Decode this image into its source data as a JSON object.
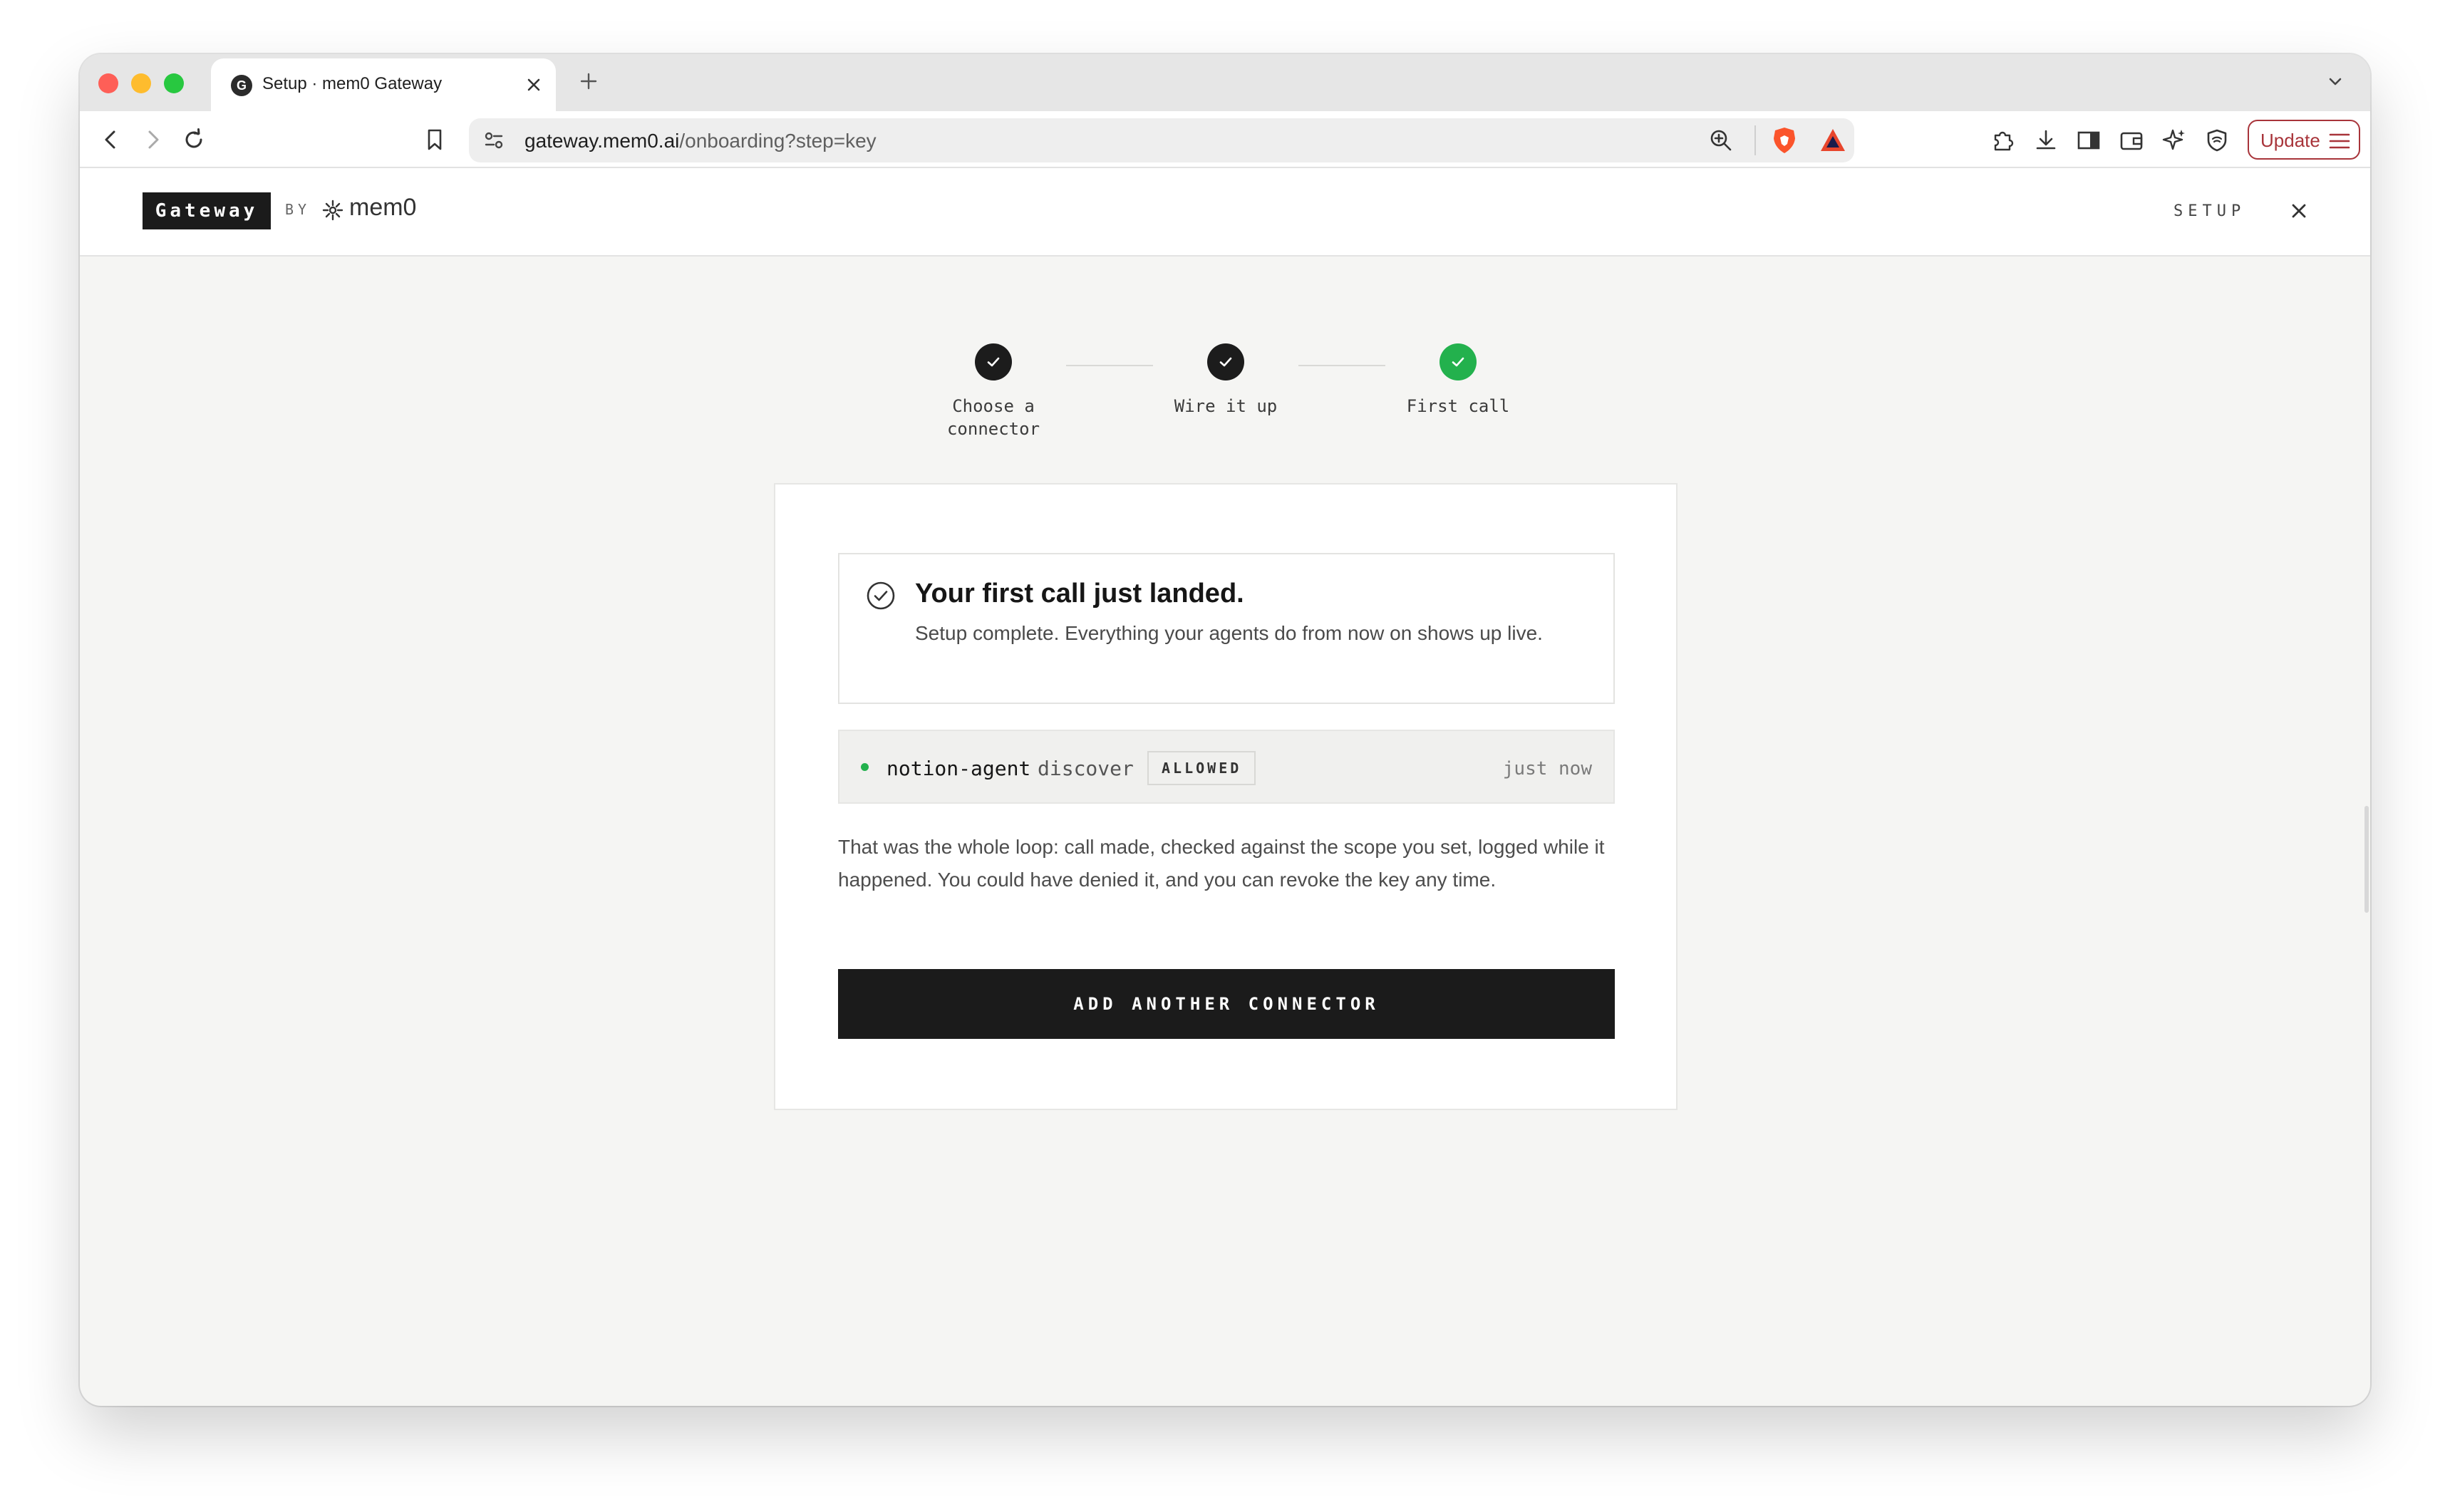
{
  "browser": {
    "tab_title": "Setup · mem0 Gateway",
    "favicon_letter": "G",
    "url_host": "gateway.mem0.ai",
    "url_path": "/onboarding?step=key",
    "update_label": "Update"
  },
  "header": {
    "logo": "Gateway",
    "by": "BY",
    "brand": "mem0",
    "section": "SETUP"
  },
  "steps": [
    {
      "label": "Choose a\nconnector",
      "status": "done"
    },
    {
      "label": "Wire it up",
      "status": "done"
    },
    {
      "label": "First call",
      "status": "current-success"
    }
  ],
  "success": {
    "title": "Your first call just landed.",
    "subtitle": "Setup complete. Everything your agents do from now on shows up live."
  },
  "event": {
    "agent": "notion-agent",
    "action": "discover",
    "status": "ALLOWED",
    "time": "just now",
    "status_color": "#23b14d"
  },
  "explanation": "That was the whole loop: call made, checked against the scope you set, logged while it happened. You could have denied it, and you can revoke the key any time.",
  "cta_label": "ADD ANOTHER CONNECTOR",
  "colors": {
    "accent_dark": "#1b1b1b",
    "success_green": "#23b14d",
    "update_red": "#a8343a"
  }
}
